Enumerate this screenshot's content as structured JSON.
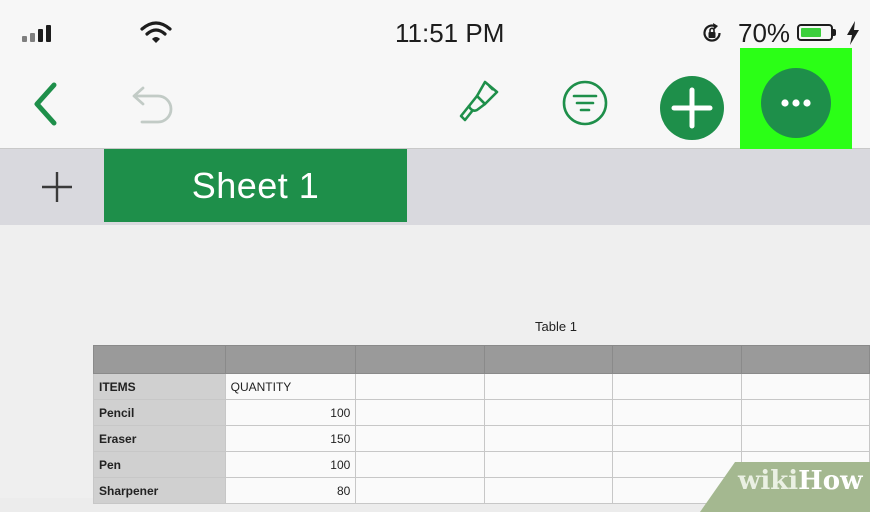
{
  "status_bar": {
    "time": "11:51 PM",
    "battery_percent": "70%",
    "battery_level": 0.7,
    "battery_fill_color": "#3ccf3c"
  },
  "toolbar": {
    "icons": [
      "back-chevron-icon",
      "undo-icon",
      "paintbrush-icon",
      "format-list-icon",
      "plus-icon",
      "more-ellipsis-icon"
    ],
    "accent_color": "#1e8f4a",
    "highlight_color": "#2bff16"
  },
  "tabs": {
    "add_icon": "plus-icon",
    "active_tab_label": "Sheet 1"
  },
  "table": {
    "title": "Table 1",
    "columns": [
      "ITEMS",
      "QUANTITY"
    ],
    "rows": [
      {
        "item": "Pencil",
        "quantity": "100"
      },
      {
        "item": "Eraser",
        "quantity": "150"
      },
      {
        "item": "Pen",
        "quantity": "100"
      },
      {
        "item": "Sharpener",
        "quantity": "80"
      }
    ]
  },
  "watermark": {
    "part1": "wiki",
    "part2": "How"
  }
}
